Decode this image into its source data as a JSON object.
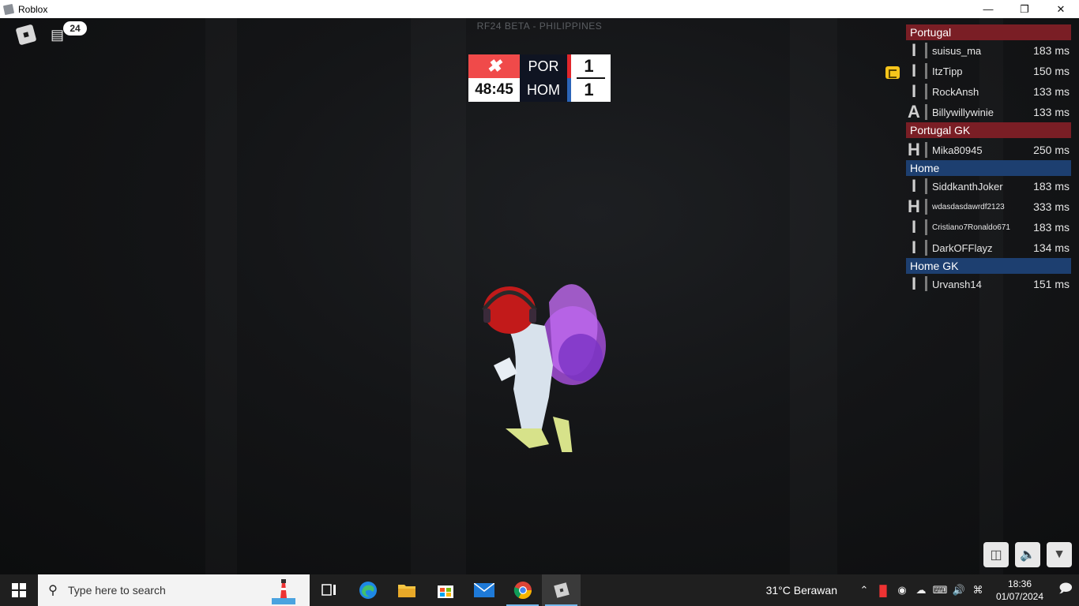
{
  "window": {
    "title": "Roblox"
  },
  "hud": {
    "chat_badge": "24",
    "server_name": "RF24 BETA - PHILIPPINES"
  },
  "scoreboard": {
    "logo": "ѧ",
    "timer": "48:45",
    "home_team": "POR",
    "away_team": "HOM",
    "home_score": "1",
    "away_score": "1"
  },
  "playerlist": {
    "groups": [
      {
        "name": "Portugal",
        "color": "#7a1e25",
        "players": [
          {
            "role": "I",
            "name": "suisus_ma",
            "ping": "183 ms"
          },
          {
            "role": "I",
            "name": "ItzTipp",
            "ping": "150 ms"
          },
          {
            "role": "I",
            "name": "RockAnsh",
            "ping": "133 ms"
          },
          {
            "role": "A",
            "name": "Billywillywinie",
            "ping": "133 ms"
          }
        ]
      },
      {
        "name": "Portugal GK",
        "color": "#7a1e25",
        "players": [
          {
            "role": "H",
            "name": "Mika80945",
            "ping": "250 ms"
          }
        ]
      },
      {
        "name": "Home",
        "color": "#1d3f70",
        "players": [
          {
            "role": "I",
            "name": "SiddkanthJoker",
            "ping": "183 ms"
          },
          {
            "role": "H",
            "name": "wdasdasdawrdf2123",
            "ping": "333 ms"
          },
          {
            "role": "I",
            "name": "Cristiano7Ronaldo671",
            "ping": "183 ms"
          },
          {
            "role": "I",
            "name": "DarkOFFlayz",
            "ping": "134 ms"
          }
        ]
      },
      {
        "name": "Home GK",
        "color": "#1d3f70",
        "players": [
          {
            "role": "I",
            "name": "Urvansh14",
            "ping": "151 ms"
          }
        ]
      }
    ]
  },
  "game_buttons": [
    {
      "icon": "backpack-icon"
    },
    {
      "icon": "volume-icon"
    },
    {
      "icon": "menu-triangle-icon"
    }
  ],
  "taskbar": {
    "search_placeholder": "Type here to search",
    "weather": "31°C  Berawan",
    "time": "18:36",
    "date": "01/07/2024",
    "apps": [
      "task-view",
      "edge",
      "file-explorer",
      "microsoft-store",
      "mail",
      "chrome",
      "roblox"
    ]
  }
}
